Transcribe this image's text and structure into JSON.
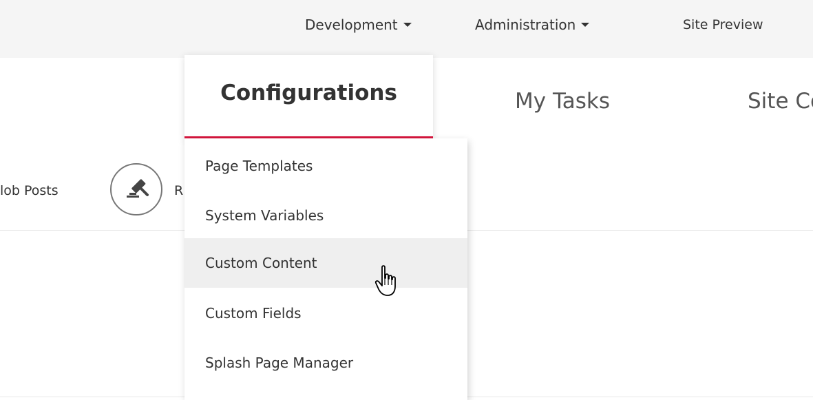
{
  "topnav": {
    "development": "Development",
    "administration": "Administration",
    "site_preview": "Site Preview"
  },
  "tabs": {
    "configurations": "Configurations",
    "my_tasks": "My Tasks",
    "site_content_partial": "Site Co"
  },
  "toolbar": {
    "job_posts_partial": "lob Posts",
    "r_partial": "R",
    "icon": "gavel-icon"
  },
  "dropdown": {
    "items": [
      "Page Templates",
      "System Variables",
      "Custom Content",
      "Custom Fields",
      "Splash Page Manager"
    ],
    "hovered_index": 2
  },
  "colors": {
    "accent": "#d6163d",
    "topnav_bg": "#f5f5f5",
    "hover_bg": "#efefef"
  }
}
